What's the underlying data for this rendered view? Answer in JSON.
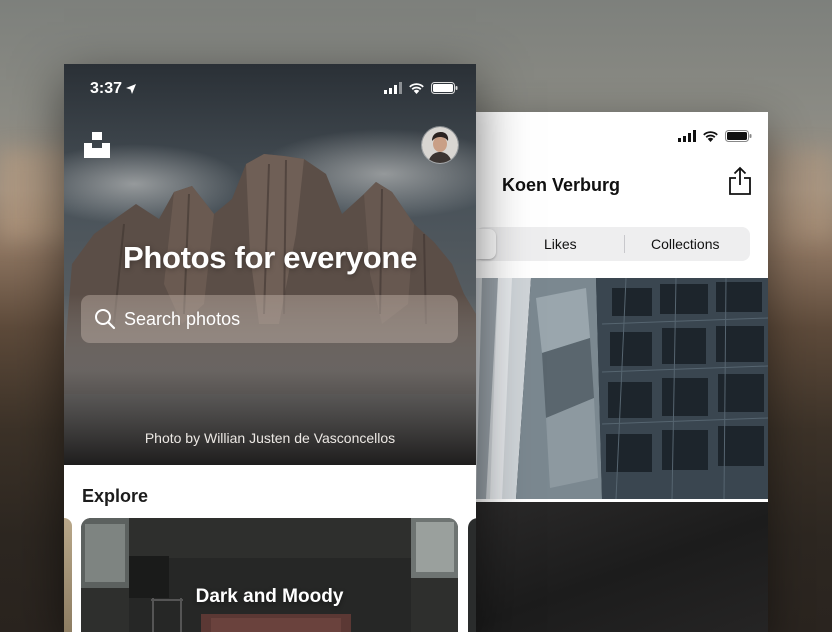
{
  "front_screen": {
    "status_bar": {
      "time": "3:37"
    },
    "hero": {
      "headline": "Photos for everyone",
      "search": {
        "placeholder": "Search photos"
      },
      "credit": "Photo by Willian Justen de Vasconcellos"
    },
    "explore": {
      "title": "Explore",
      "cards": [
        {
          "label": "Dark and Moody"
        }
      ]
    }
  },
  "back_screen": {
    "profile_name": "Koen Verburg",
    "tabs": [
      {
        "label": ""
      },
      {
        "label": "Likes"
      },
      {
        "label": "Collections"
      }
    ]
  },
  "icons": {
    "location": "location-arrow-icon",
    "signal": "signal-icon",
    "wifi": "wifi-icon",
    "battery": "battery-icon",
    "logo": "unsplash-logo-icon",
    "share": "share-icon",
    "search": "search-icon"
  }
}
